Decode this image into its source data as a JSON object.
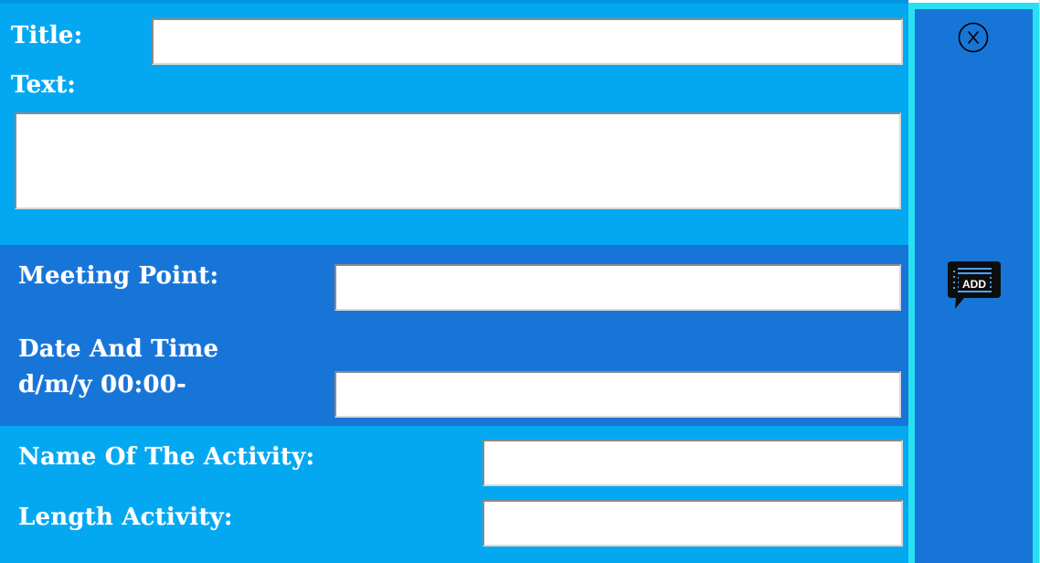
{
  "form": {
    "title_label": "Title:",
    "title_value": "",
    "text_label": "Text:",
    "text_value": "",
    "meeting_point_label": "Meeting Point:",
    "meeting_point_value": "",
    "date_time_label_line1": "Date And Time",
    "date_time_label_line2": "d/m/y 00:00-",
    "date_time_value": "",
    "activity_name_label": "Name Of The Activity:",
    "activity_name_value": "",
    "activity_length_label": "Length Activity:",
    "activity_length_value": ""
  },
  "side_panel": {
    "close_icon": "close-circle-x-icon",
    "add_icon": "add-comment-icon",
    "add_label": "ADD",
    "border_color": "#29e0f2",
    "background_color": "#1775d8"
  },
  "colors": {
    "form_background": "#03a8f1",
    "band_background": "#1775d8",
    "label_text": "#ffffff"
  }
}
